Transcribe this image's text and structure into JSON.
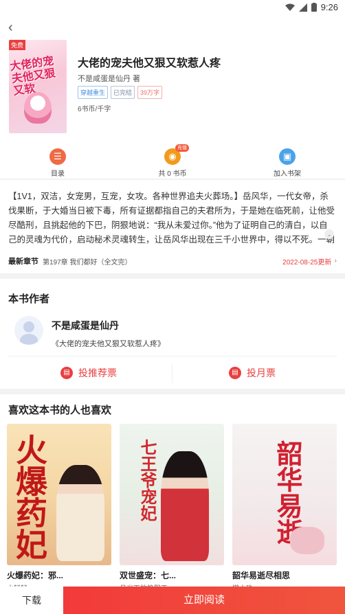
{
  "status_bar": {
    "time": "9:26"
  },
  "book": {
    "title": "大佬的宠夫他又狠又软惹人疼",
    "author": "不是咸蛋是仙丹 著",
    "tags": [
      "穿越重生",
      "已完结",
      "39万字"
    ],
    "price": "6书币/千字",
    "cover": {
      "free_label": "免费",
      "cover_title": "大佬的宠夫他又狠又软"
    }
  },
  "actions": {
    "catalog": "目录",
    "coins": "共 0 书币",
    "coins_badge": "充值",
    "shelf": "加入书架"
  },
  "intro": {
    "text": "【1V1，双洁，女宠男，互宠，女攻。各种世界追夫火葬场。】岳风华，一代女帝，杀伐果断，于大婚当日被下毒，所有证据都指自己的夫君所为，于是她在临死前，让他受尽酷刑，且挑起他的下巴，阴狠地说：“我从未爱过你。”他为了证明自己的清白，以自己的灵魂为代价，启动秘术灵魂转生，让岳风华出现在三千小世界中，得以不死。一朝重生，岳风华...",
    "latest_label": "最新章节",
    "latest_chapter": "第197章 我们都好（全文完）",
    "latest_date": "2022-08-25更新"
  },
  "author_section": {
    "title": "本书作者",
    "name": "不是咸蛋是仙丹",
    "book": "《大佬的宠夫他又狠又软惹人疼》",
    "vote_recommend": "投推荐票",
    "vote_monthly": "投月票"
  },
  "recommend": {
    "title": "喜欢这本书的人也喜欢",
    "books": [
      {
        "title": "火爆药妃：邪...",
        "author": "水轻轻",
        "cover_text": "火爆药妃"
      },
      {
        "title": "双世盛宠：七...",
        "author": "月光下的艳阳天",
        "cover_text": "七王爷宠妃"
      },
      {
        "title": "韶华易逝尽相思",
        "author": "懒小玖",
        "cover_text": "韶华易逝"
      }
    ]
  },
  "bottom": {
    "download": "下载",
    "read_now": "立即阅读"
  },
  "colors": {
    "accent_red": "#e84040",
    "catalog_icon": "#f06a45",
    "coin_icon": "#f29a1b",
    "shelf_icon": "#4aa3e8"
  }
}
